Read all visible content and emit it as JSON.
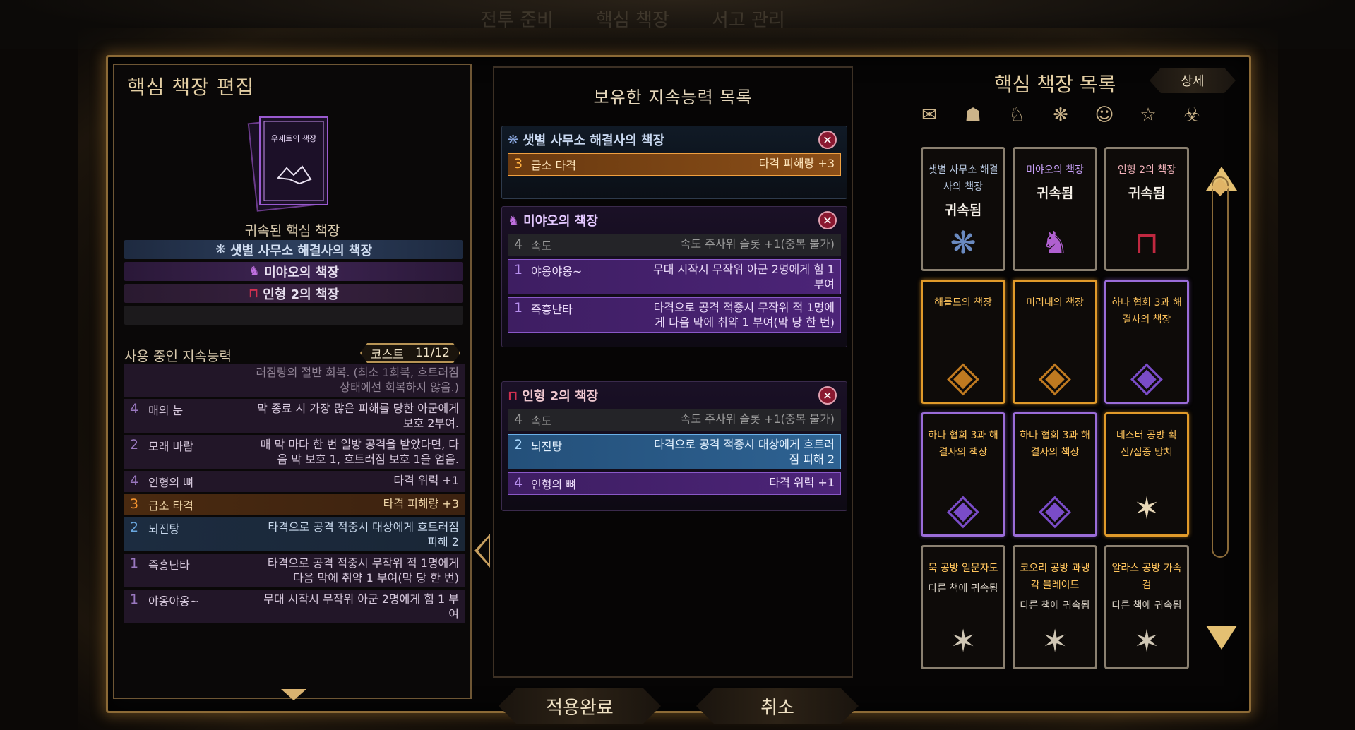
{
  "background_tabs": [
    "전투 준비",
    "핵심 책장",
    "서고 관리"
  ],
  "left": {
    "title": "핵심 책장 편집",
    "book_name": "우제트의 책장",
    "bound_label": "귀속된 핵심 책장",
    "bound": [
      {
        "label": "샛별 사무소 해결사의 책장",
        "style": "blue",
        "icon": "star-sigil-icon"
      },
      {
        "label": "미야오의 책장",
        "style": "purple",
        "icon": "cat-icon"
      },
      {
        "label": "인형 2의 책장",
        "style": "dark",
        "icon": "ribbon-icon"
      },
      {
        "label": "",
        "style": "empty"
      }
    ],
    "using_title": "사용 중인 지속능력",
    "cost_label": "코스트",
    "cost_value": "11/12",
    "using": [
      {
        "n": "",
        "name": "",
        "desc": "러짐량의 절반 회복. (최소 1회복, 흐트러짐 상태에선 회복하지 않음.)",
        "style": "cut"
      },
      {
        "n": "4",
        "name": "매의 눈",
        "desc": "막 종료 시 가장 많은 피해를 당한 아군에게 보호 2부여.",
        "style": "plain",
        "ncolor": "purple"
      },
      {
        "n": "2",
        "name": "모래 바람",
        "desc": "매 막 마다 한 번 일방 공격을 받았다면, 다음 막 보호 1, 흐트러짐 보호 1을 얻음.",
        "style": "plain",
        "ncolor": "purple"
      },
      {
        "n": "4",
        "name": "인형의 뼈",
        "desc": "타격 위력 +1",
        "style": "plain",
        "ncolor": "purple"
      },
      {
        "n": "3",
        "name": "급소 타격",
        "desc": "타격 피해량 +3",
        "style": "orange"
      },
      {
        "n": "2",
        "name": "뇌진탕",
        "desc": "타격으로 공격 적중시 대상에게 흐트러짐 피해 2",
        "style": "blue"
      },
      {
        "n": "1",
        "name": "즉흥난타",
        "desc": "타격으로 공격 적중시 무작위 적 1명에게 다음 막에 취약 1 부여(막 당 한 번)",
        "style": "plain",
        "ncolor": "purple"
      },
      {
        "n": "1",
        "name": "야옹야옹~",
        "desc": "무대 시작시 무작위 아군 2명에게 힘 1 부여",
        "style": "plain",
        "ncolor": "purple"
      }
    ]
  },
  "middle": {
    "title": "보유한 지속능력 목록",
    "groups": [
      {
        "title": "샛별 사무소 해결사의 책장",
        "title_color": "#c8d8f0",
        "icon": "star-sigil-icon",
        "rows": [
          {
            "n": "3",
            "name": "급소 타격",
            "desc": "타격 피해량 +3",
            "style": "orange"
          }
        ]
      },
      {
        "title": "미야오의 책장",
        "title_color": "#e4c8ff",
        "icon": "cat-icon",
        "rows": [
          {
            "n": "4",
            "name": "속도",
            "desc": "속도 주사위 슬롯 +1(중복 불가)",
            "style": "gray"
          },
          {
            "n": "1",
            "name": "야옹야옹~",
            "desc": "무대 시작시 무작위 아군 2명에게 힘 1 부여",
            "style": "purple"
          },
          {
            "n": "1",
            "name": "즉흥난타",
            "desc": "타격으로 공격 적중시 무작위 적 1명에게 다음 막에 취약 1 부여(막 당 한 번)",
            "style": "purple"
          }
        ]
      },
      {
        "title": "인형 2의 책장",
        "title_color": "#f0c8d0",
        "icon": "ribbon-icon",
        "rows": [
          {
            "n": "4",
            "name": "속도",
            "desc": "속도 주사위 슬롯 +1(중복 불가)",
            "style": "gray"
          },
          {
            "n": "2",
            "name": "뇌진탕",
            "desc": "타격으로 공격 적중시 대상에게 흐트러짐 피해 2",
            "style": "blue"
          },
          {
            "n": "4",
            "name": "인형의 뼈",
            "desc": "타격 위력 +1",
            "style": "purple"
          }
        ]
      }
    ],
    "close_glyph": "✕"
  },
  "buttons": {
    "apply": "적용완료",
    "cancel": "취소"
  },
  "right": {
    "title": "핵심 책장 목록",
    "detail_label": "상세",
    "filters": [
      "speech-bubble-icon",
      "ghost-icon",
      "wolf-icon",
      "star-sigil-icon",
      "mask-icon",
      "cloud-star-icon",
      "hazard-icon"
    ],
    "cards": [
      {
        "title": "샛별 사무소 해결사의 책장",
        "status": "귀속됨",
        "frame": "gray",
        "tcolor": "blue",
        "emblem": "❋",
        "ecolor": "#6a8ac0"
      },
      {
        "title": "미야오의 책장",
        "status": "귀속됨",
        "frame": "gray",
        "tcolor": "vio",
        "emblem": "♞",
        "ecolor": "#b060d0"
      },
      {
        "title": "인형 2의 책장",
        "status": "귀속됨",
        "frame": "gray",
        "tcolor": "red",
        "emblem": "⊓",
        "ecolor": "#c02840"
      },
      {
        "title": "해롤드의 책장",
        "status": "",
        "frame": "gold",
        "tcolor": "gold",
        "emblem": "◈",
        "ecolor": "#c07a20"
      },
      {
        "title": "미리내의 책장",
        "status": "",
        "frame": "gold",
        "tcolor": "gold",
        "emblem": "◈",
        "ecolor": "#c07a20"
      },
      {
        "title": "하나 협회 3과 해결사의 책장",
        "status": "",
        "frame": "vio",
        "tcolor": "gold",
        "emblem": "◈",
        "ecolor": "#7a4cc8"
      },
      {
        "title": "하나 협회 3과 해결사의 책장",
        "status": "",
        "frame": "vio",
        "tcolor": "gold",
        "emblem": "◈",
        "ecolor": "#7a4cc8"
      },
      {
        "title": "하나 협회 3과 해결사의 책장",
        "status": "",
        "frame": "vio",
        "tcolor": "gold",
        "emblem": "◈",
        "ecolor": "#7a4cc8"
      },
      {
        "title": "네스터 공방 확산/집중 망치",
        "status": "",
        "frame": "gold",
        "tcolor": "gold",
        "emblem": "✶",
        "ecolor": "#e8d8b8"
      },
      {
        "title": "묵 공방 일문자도",
        "status": "다른 책에 귀속됨",
        "frame": "gray",
        "tcolor": "gold",
        "emblem": "✶",
        "ecolor": "#cfc6b4"
      },
      {
        "title": "코오리 공방 과냉각 블레이드",
        "status": "다른 책에 귀속됨",
        "frame": "gray",
        "tcolor": "gold",
        "emblem": "✶",
        "ecolor": "#cfc6b4"
      },
      {
        "title": "알라스 공방 가속검",
        "status": "다른 책에 귀속됨",
        "frame": "gray",
        "tcolor": "gold",
        "emblem": "✶",
        "ecolor": "#cfc6b4"
      }
    ]
  }
}
